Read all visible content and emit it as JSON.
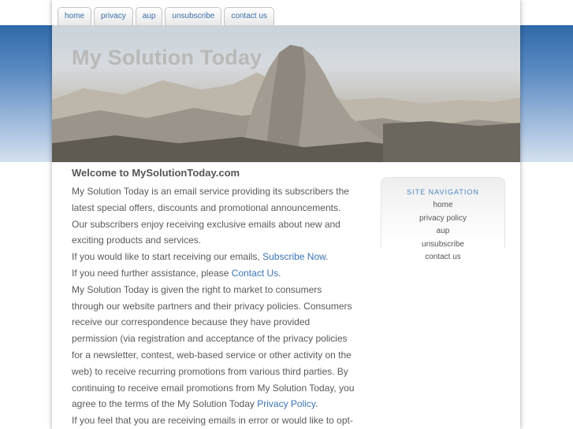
{
  "tabs": [
    {
      "label": "home"
    },
    {
      "label": "privacy"
    },
    {
      "label": "aup"
    },
    {
      "label": "unsubscribe"
    },
    {
      "label": "contact us"
    }
  ],
  "header": {
    "site_title": "My Solution Today"
  },
  "main": {
    "heading": "Welcome to MySolutionToday.com",
    "para1": "My Solution Today is an email service providing its subscribers the latest special offers, discounts and promotional announcements. Our subscribers enjoy receiving exclusive emails about new and exciting products and services.",
    "para2_text": "If you would like to start receiving our emails, ",
    "para2_link": "Subscribe Now",
    "para2_end": ".",
    "para3_text": "If you need further assistance, please ",
    "para3_link": "Contact Us",
    "para3_end": ".",
    "para4_text": "My Solution Today is given the right to market to consumers through our website partners and their privacy policies. Consumers receive our correspondence because they have provided permission (via registration and acceptance of the privacy policies for a newsletter, contest, web-based service or other activity on the web) to receive recurring promotions from various third parties. By continuing to receive email promotions from My Solution Today, you agree to the terms of the My Solution Today ",
    "para4_link": "Privacy Policy",
    "para4_end": ".",
    "para5_text": "If you feel that you are receiving emails in error or would like to opt-"
  },
  "sidebar": {
    "title": "SITE NAVIGATION",
    "links": [
      {
        "label": "home"
      },
      {
        "label": "privacy policy"
      },
      {
        "label": "aup"
      },
      {
        "label": "unsubscribe"
      },
      {
        "label": "contact us"
      }
    ]
  },
  "colors": {
    "link": "#3a74b4",
    "tab_text": "#3a6ea8",
    "background_band": "#2f69a8"
  }
}
